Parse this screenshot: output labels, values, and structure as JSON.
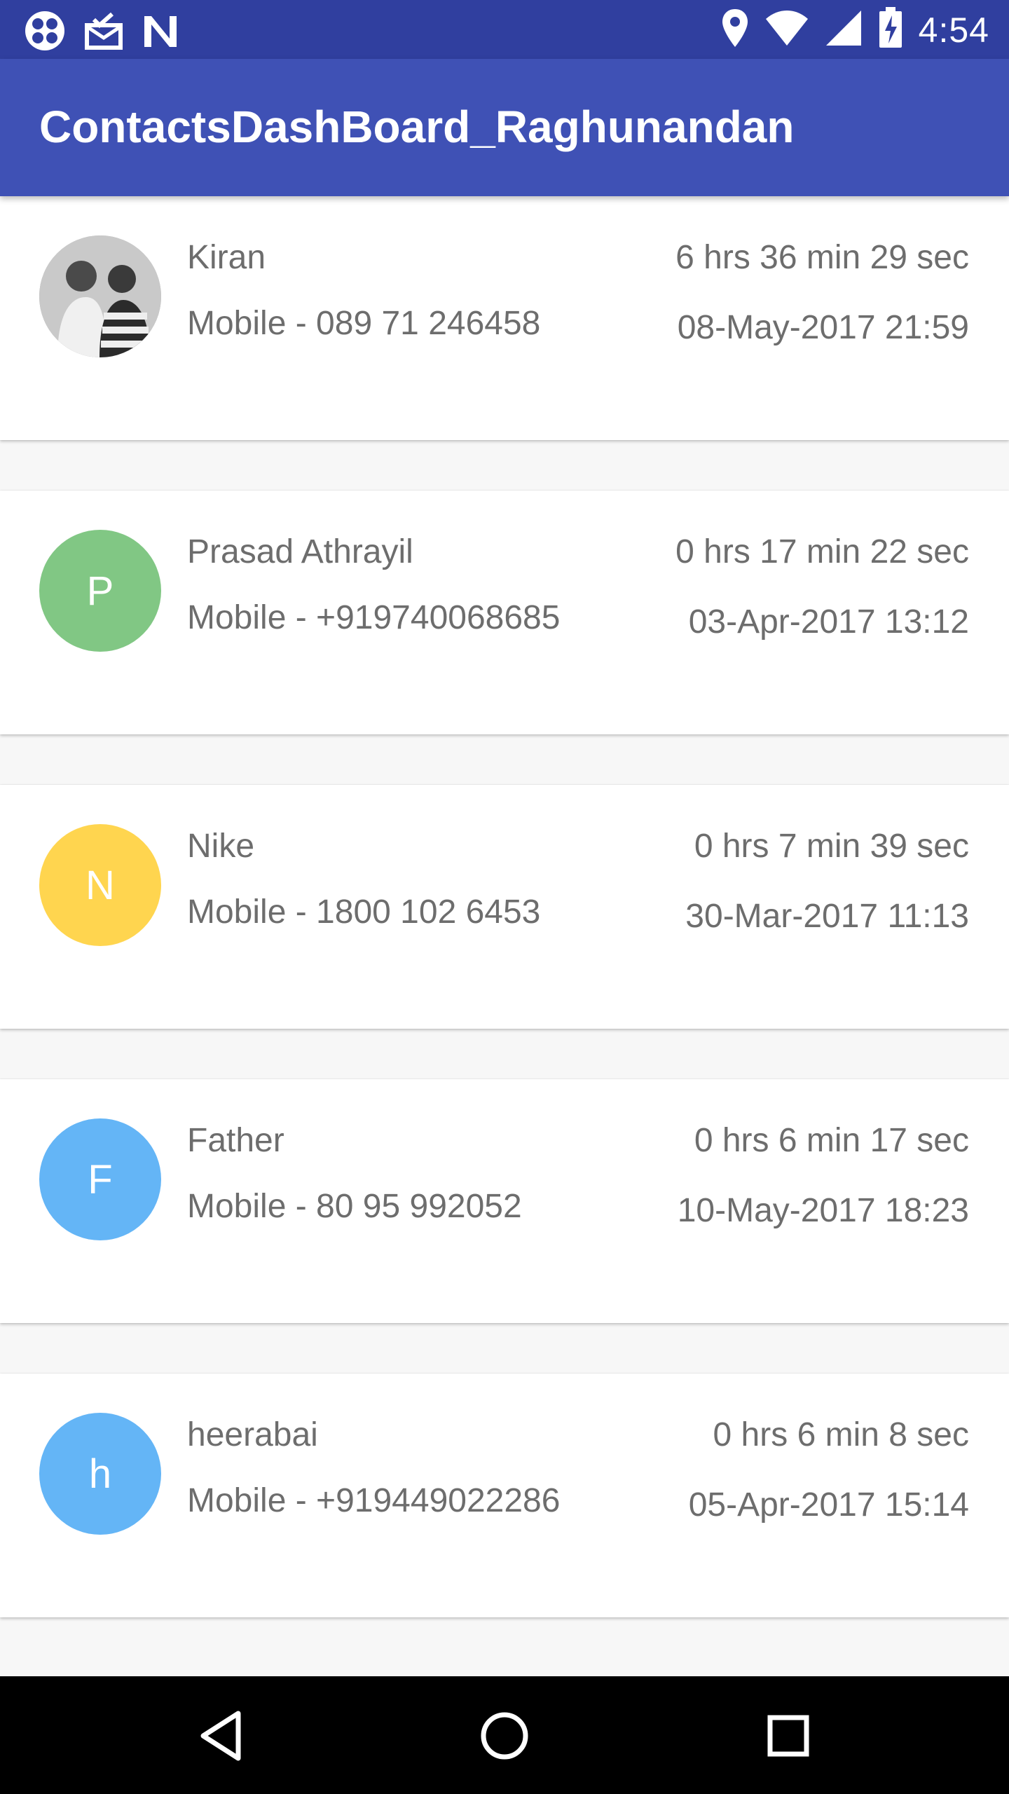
{
  "status_bar": {
    "time": "4:54",
    "left_icons": [
      "app-launcher-icon",
      "mail-check-icon",
      "n-logo-icon"
    ],
    "right_icons": [
      "location-icon",
      "wifi-icon",
      "signal-icon",
      "battery-charging-icon"
    ]
  },
  "app_bar": {
    "title": "ContactsDashBoard_Raghunandan",
    "color": "#3f51b5"
  },
  "contacts": [
    {
      "name": "Kiran",
      "mobile": "Mobile - 089 71 246458",
      "duration": "6 hrs 36 min 29 sec",
      "datetime": "08-May-2017 21:59",
      "avatar_type": "photo",
      "initial": "",
      "avatar_color": "#9e9e9e"
    },
    {
      "name": "Prasad Athrayil",
      "mobile": "Mobile - +919740068685",
      "duration": "0 hrs 17 min 22 sec",
      "datetime": "03-Apr-2017 13:12",
      "avatar_type": "initial",
      "initial": "P",
      "avatar_color": "#81c784"
    },
    {
      "name": "Nike",
      "mobile": "Mobile - 1800 102 6453",
      "duration": "0 hrs 7 min 39 sec",
      "datetime": "30-Mar-2017 11:13",
      "avatar_type": "initial",
      "initial": "N",
      "avatar_color": "#ffd54f"
    },
    {
      "name": "Father",
      "mobile": "Mobile - 80 95 992052",
      "duration": "0 hrs 6 min 17 sec",
      "datetime": "10-May-2017 18:23",
      "avatar_type": "initial",
      "initial": "F",
      "avatar_color": "#64b5f6"
    },
    {
      "name": "heerabai",
      "mobile": "Mobile - +919449022286",
      "duration": "0 hrs 6 min 8 sec",
      "datetime": "05-Apr-2017 15:14",
      "avatar_type": "initial",
      "initial": "h",
      "avatar_color": "#64b5f6"
    }
  ],
  "nav_bar": {
    "buttons": [
      "back-icon",
      "home-icon",
      "recents-icon"
    ]
  }
}
